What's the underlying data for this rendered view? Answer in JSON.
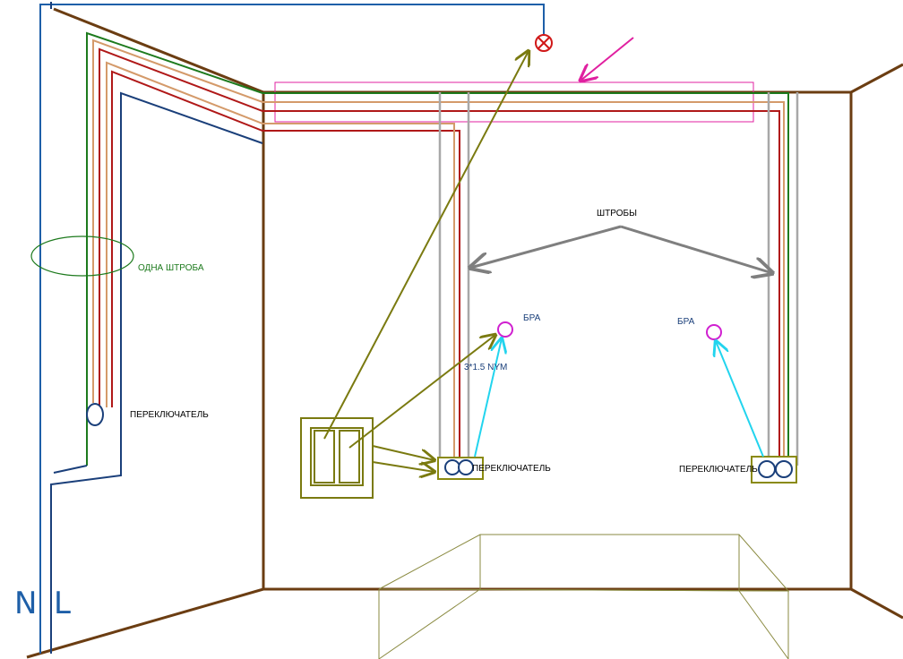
{
  "labels": {
    "odna_shtroba": "ОДНА ШТРОБА",
    "switch_left_wall": "ПЕРЕКЛЮЧАТЕЛЬ",
    "shtroby": "ШТРОБЫ",
    "bra_left": "БРА",
    "bra_right": "БРА",
    "cable_spec": "3*1.5 NYM",
    "switch_center": "ПЕРЕКЛЮЧАТЕЛЬ",
    "switch_right": "ПЕРЕКЛЮЧАТЕЛЬ",
    "neutral": "N",
    "line": "L"
  },
  "colors": {
    "wall": "#6b3d12",
    "blue_wire": "#1e5fa8",
    "dark_blue_wire": "#1a3f7a",
    "green_wire": "#1d7a1d",
    "red_wire": "#b01818",
    "tan_wire": "#d49a6a",
    "gray_wire": "#a8a8a8",
    "olive_arrow": "#7a7a10",
    "cyan_arrow": "#22d4ee",
    "magenta": "#e020a0",
    "bra_circle": "#d020d0",
    "lamp": "#d01818",
    "text_green": "#1d7a1d",
    "text_blue": "#1a3f7a",
    "text_black": "#000000"
  },
  "icons": {
    "lamp": "ceiling-lamp-icon",
    "bra_left": "wall-sconce-icon",
    "bra_right": "wall-sconce-icon",
    "switch_box": "double-switch-icon"
  }
}
